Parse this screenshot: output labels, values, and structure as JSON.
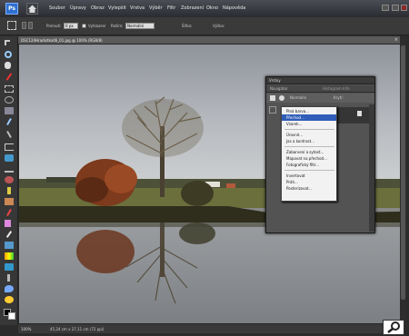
{
  "app": {
    "logo_text": "Ps",
    "brand_color": "#2f6fd0"
  },
  "menubar": {
    "items": [
      "Soubor",
      "Úpravy",
      "Obraz",
      "Vylepšit",
      "Vrstva",
      "Výběr",
      "Filtr",
      "Zobrazení",
      "Okno",
      "Nápověda"
    ]
  },
  "optionsbar": {
    "feather_label": "Prolnutí:",
    "feather_value": "0 px",
    "antialias_label": "Vyhlazení",
    "mode_label": "Režim:",
    "mode_value": "Normální",
    "width_label": "Šířka:",
    "height_label": "Výška:"
  },
  "document": {
    "tab_title": "DSC124Hradistko06_01.jpg @ 100% (RGB/8)",
    "zoom": "100%",
    "status_info": "45,24 cm x 27,11 cm (72 ppi)"
  },
  "layers_panel": {
    "title": "Vrstvy",
    "tabs": [
      "Navigátor",
      "Histogram",
      "Info"
    ],
    "mode_label": "Normální",
    "opacity_label": "Krytí:"
  },
  "context_menu": {
    "items": [
      {
        "label": "Plná barva...",
        "selected": false
      },
      {
        "label": "Přechod...",
        "selected": true
      },
      {
        "label": "Vzorek...",
        "selected": false
      },
      {
        "sep": true
      },
      {
        "label": "Úrovně...",
        "selected": false
      },
      {
        "label": "Jas a kontrast...",
        "selected": false
      },
      {
        "sep": true
      },
      {
        "label": "Zabarvení a sytost...",
        "selected": false
      },
      {
        "label": "Mapovat na přechod...",
        "selected": false
      },
      {
        "label": "Fotografický filtr...",
        "selected": false
      },
      {
        "sep": true
      },
      {
        "label": "Invertovat",
        "selected": false
      },
      {
        "label": "Práh...",
        "selected": false
      },
      {
        "label": "Posterizovat...",
        "selected": false
      }
    ]
  },
  "colors": {
    "selection": "#2f5db8",
    "sky": "#c6c9cc",
    "field": "#5b6434",
    "water": "#8f9396"
  }
}
